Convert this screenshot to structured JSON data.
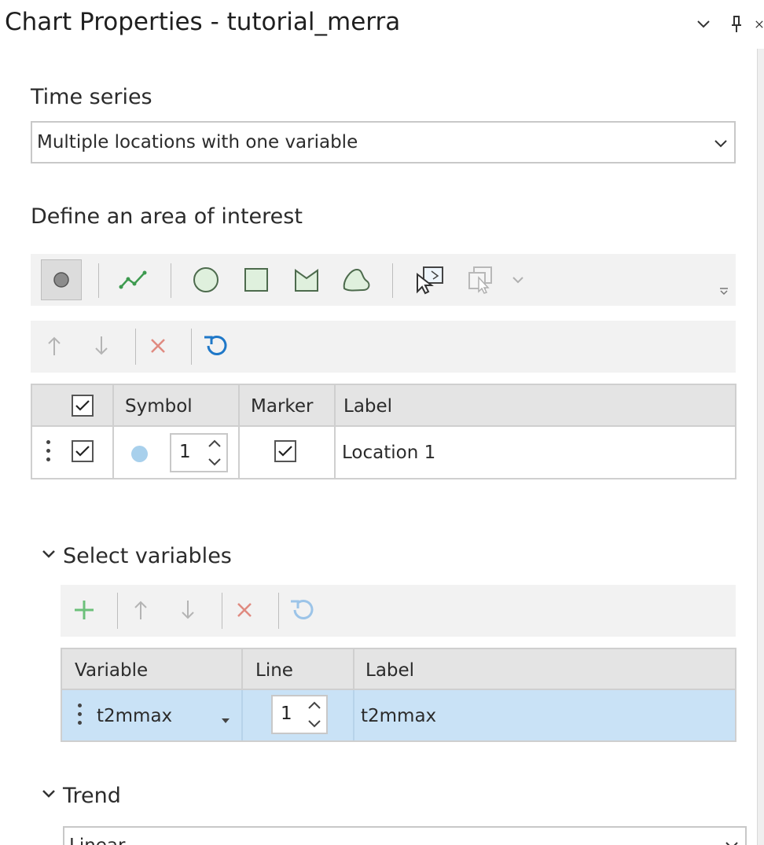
{
  "window": {
    "title": "Chart Properties - tutorial_merra",
    "icons": [
      "chevron-down-icon",
      "pin-icon",
      "close-icon"
    ]
  },
  "time_series": {
    "heading": "Time series",
    "selected": "Multiple locations with one variable"
  },
  "area_of_interest": {
    "heading": "Define an area of interest",
    "tools": [
      "point-tool-icon",
      "line-tool-icon",
      "circle-tool-icon",
      "rectangle-tool-icon",
      "polygon-tool-icon",
      "freehand-tool-icon",
      "select-features-icon",
      "select-from-layer-icon"
    ],
    "row_tools": [
      "move-up-icon",
      "move-down-icon",
      "delete-icon",
      "reset-icon"
    ],
    "columns": [
      "Symbol",
      "Marker",
      "Label"
    ],
    "rows": [
      {
        "checked": true,
        "symbol_color": "#a8d0ec",
        "symbol_size": "1",
        "marker": true,
        "label": "Location 1"
      }
    ]
  },
  "variables": {
    "heading": "Select variables",
    "row_tools": [
      "add-icon",
      "move-up-icon",
      "move-down-icon",
      "delete-icon",
      "reset-icon"
    ],
    "columns": [
      "Variable",
      "Line",
      "Label"
    ],
    "rows": [
      {
        "variable": "t2mmax",
        "line": "1",
        "label": "t2mmax"
      }
    ]
  },
  "trend": {
    "heading": "Trend",
    "selected": "Linear"
  },
  "colors": {
    "accent_blue": "#1f78c8",
    "delete_red": "#e08a80",
    "add_green": "#6cc07a",
    "selected_row": "#c9e2f6"
  }
}
